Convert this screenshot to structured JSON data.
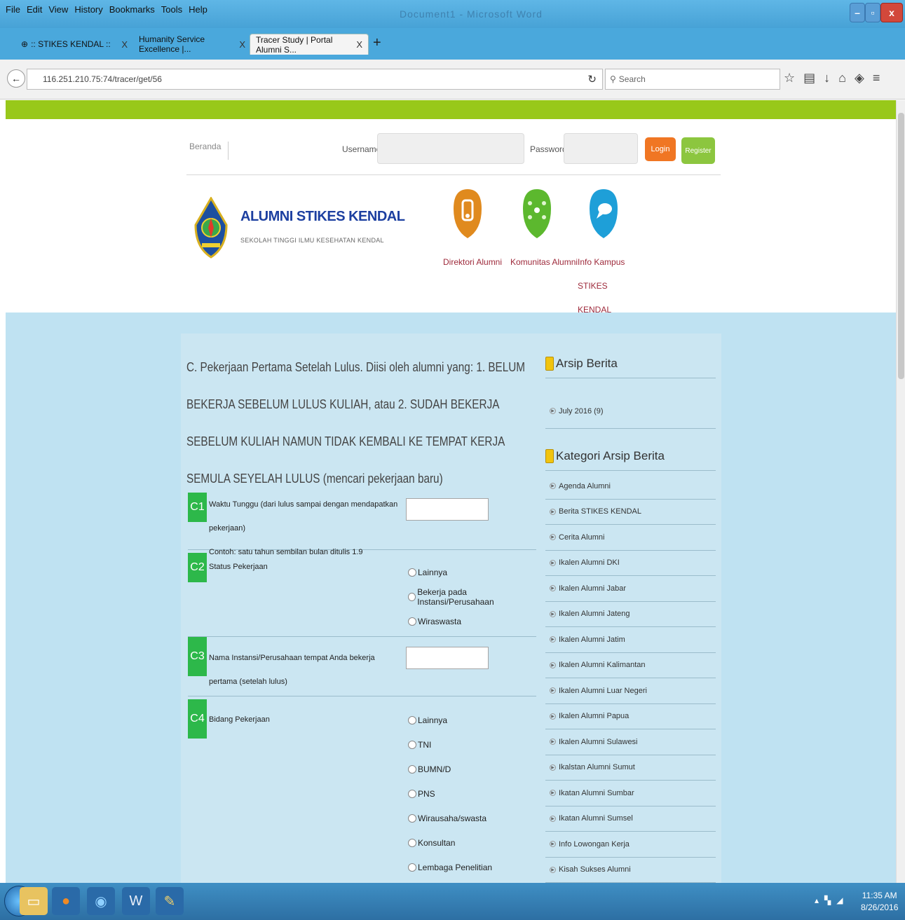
{
  "browser": {
    "menu": [
      "File",
      "Edit",
      "View",
      "History",
      "Bookmarks",
      "Tools",
      "Help"
    ],
    "window_title": "Document1 - Microsoft Word",
    "tabs": [
      {
        "label": ":: STIKES KENDAL ::",
        "active": false
      },
      {
        "label": "Humanity Service Excellence |...",
        "active": false
      },
      {
        "label": "Tracer Study | Portal Alumni S...",
        "active": true
      }
    ],
    "url": "116.251.210.75:74/tracer/get/56",
    "search_placeholder": "Search"
  },
  "header": {
    "beranda": "Beranda",
    "username_label": "Username",
    "password_label": "Password",
    "login_label": "Login",
    "register_label": "Register",
    "site_title": "ALUMNI STIKES KENDAL",
    "site_subtitle": "SEKOLAH TINGGI ILMU KESEHATAN KENDAL",
    "nav": [
      {
        "label": "Direktori Alumni",
        "color": "#e08a1e"
      },
      {
        "label": "Komunitas Alumni",
        "color": "#5cb82e"
      },
      {
        "label": "Info Kampus STIKES KENDAL",
        "color": "#1e9fd8"
      }
    ]
  },
  "form": {
    "heading": "C. Pekerjaan Pertama Setelah Lulus. Diisi oleh alumni yang: 1. BELUM BEKERJA SEBELUM LULUS KULIAH, atau 2. SUDAH BEKERJA SEBELUM KULIAH NAMUN TIDAK KEMBALI KE TEMPAT KERJA SEMULA SEYELAH LULUS (mencari pekerjaan baru)",
    "questions": [
      {
        "num": "C1",
        "text": "Waktu Tunggu (dari lulus sampai dengan mendapatkan pekerjaan)",
        "hint": "Contoh: satu tahun sembilan bulan ditulis 1.9"
      },
      {
        "num": "C2",
        "text": "Status Pekerjaan",
        "options": [
          "Lainnya",
          "Bekerja pada Instansi/Perusahaan",
          "Wiraswasta"
        ]
      },
      {
        "num": "C3",
        "text": "Nama Instansi/Perusahaan tempat Anda bekerja pertama (setelah lulus)"
      },
      {
        "num": "C4",
        "text": "Bidang Pekerjaan",
        "options": [
          "Lainnya",
          "TNI",
          "BUMN/D",
          "PNS",
          "Wirausaha/swasta",
          "Konsultan",
          "Lembaga Penelitian"
        ]
      }
    ]
  },
  "sidebar": {
    "archive_title": "Arsip Berita",
    "archive_items": [
      "July 2016 (9)"
    ],
    "category_title": "Kategori Arsip Berita",
    "categories": [
      "Agenda Alumni",
      "Berita STIKES KENDAL",
      "Cerita Alumni",
      "Ikalen Alumni DKI",
      "Ikalen Alumni Jabar",
      "Ikalen Alumni Jateng",
      "Ikalen Alumni Jatim",
      "Ikalen Alumni Kalimantan",
      "Ikalen Alumni Luar Negeri",
      "Ikalen Alumni Papua",
      "Ikalen Alumni Sulawesi",
      "Ikalstan Alumni Sumut",
      "Ikatan Alumni Sumbar",
      "Ikatan Alumni Sumsel",
      "Info Lowongan Kerja",
      "Kisah Sukses Alumni"
    ]
  },
  "taskbar": {
    "time": "11:35 AM",
    "date": "8/26/2016"
  }
}
